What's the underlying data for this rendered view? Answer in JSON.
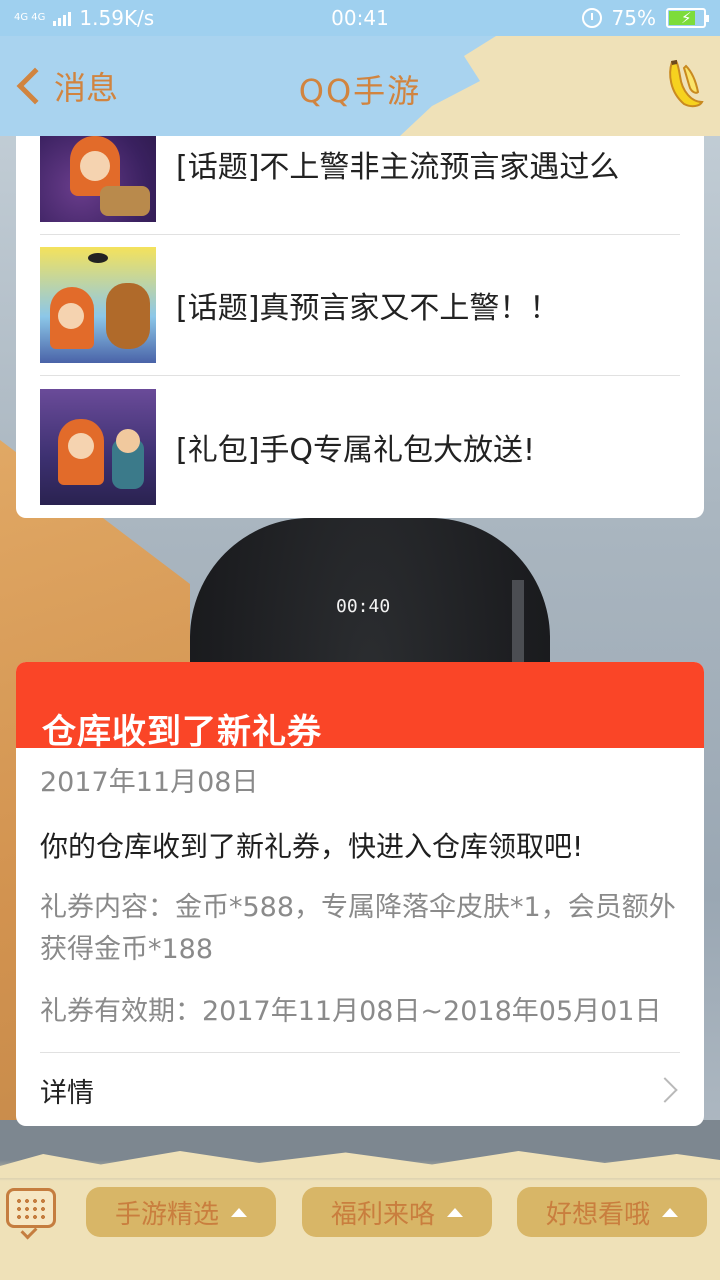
{
  "status_bar": {
    "network": "4G 4G",
    "speed": "1.59K/s",
    "time": "00:41",
    "battery": "75%",
    "battery_level": 0.75,
    "icons": [
      "signal-icon",
      "alarm-icon",
      "battery-icon"
    ]
  },
  "header": {
    "back_label": "消息",
    "title": "QQ手游",
    "right_icon": "banana-icon"
  },
  "articles": [
    {
      "title": "[话题]不上警非主流预言家遇过么"
    },
    {
      "title": "[话题]真预言家又不上警！！"
    },
    {
      "title": "[礼包]手Q专属礼包大放送!"
    }
  ],
  "background": {
    "video_time": "00:40"
  },
  "notice": {
    "title": "仓库收到了新礼券",
    "date": "2017年11月08日",
    "main_text": "你的仓库收到了新礼券，快进入仓库领取吧!",
    "content": "礼券内容：金币*588，专属降落伞皮肤*1，会员额外获得金币*188",
    "validity": "礼券有效期：2017年11月08日~2018年05月01日",
    "detail_label": "详情"
  },
  "bottom_menu": {
    "keyboard_icon": "keyboard-icon",
    "items": [
      {
        "label": "手游精选"
      },
      {
        "label": "福利来咯"
      },
      {
        "label": "好想看哦"
      }
    ]
  },
  "colors": {
    "status_bar": "#9fd0ef",
    "header": "#a9d3ef",
    "accent_orange": "#d1843f",
    "notice_red": "#fa4527",
    "menu_button": "#d8b667",
    "bottom_bar": "#efe1b8"
  }
}
